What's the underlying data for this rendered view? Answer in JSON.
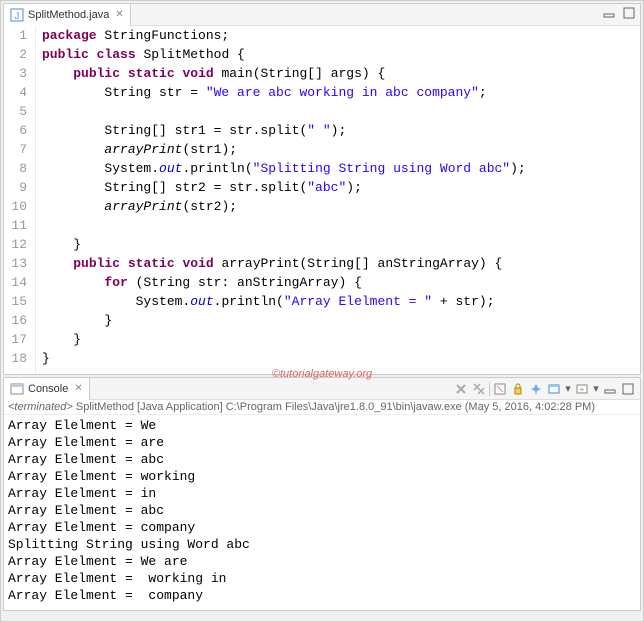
{
  "editor": {
    "tab_label": "SplitMethod.java",
    "code_lines": [
      {
        "n": "1",
        "html": "<span class='kw'>package</span> StringFunctions;"
      },
      {
        "n": "2",
        "html": "<span class='kw'>public</span> <span class='kw'>class</span> SplitMethod {"
      },
      {
        "n": "3",
        "html": "    <span class='kw'>public</span> <span class='kw'>static</span> <span class='kw'>void</span> main(String[] args) {"
      },
      {
        "n": "4",
        "html": "        String str = <span class='str'>\"We are abc working in abc company\"</span>;"
      },
      {
        "n": "5",
        "html": ""
      },
      {
        "n": "6",
        "html": "        String[] str1 = str.split(<span class='str'>\" \"</span>);"
      },
      {
        "n": "7",
        "html": "        <span class='mtd'>arrayPrint</span>(str1);"
      },
      {
        "n": "8",
        "html": "        System.<span class='fld'>out</span>.println(<span class='str'>\"Splitting String using Word abc\"</span>);"
      },
      {
        "n": "9",
        "html": "        String[] str2 = str.split(<span class='str'>\"abc\"</span>);"
      },
      {
        "n": "10",
        "html": "        <span class='mtd'>arrayPrint</span>(str2);"
      },
      {
        "n": "11",
        "html": ""
      },
      {
        "n": "12",
        "html": "    }"
      },
      {
        "n": "13",
        "html": "    <span class='kw'>public</span> <span class='kw'>static</span> <span class='kw'>void</span> arrayPrint(String[] anStringArray) {"
      },
      {
        "n": "14",
        "html": "        <span class='kw'>for</span> (String str: anStringArray) {"
      },
      {
        "n": "15",
        "html": "            System.<span class='fld'>out</span>.println(<span class='str'>\"Array Elelment = \"</span> + str);"
      },
      {
        "n": "16",
        "html": "        }"
      },
      {
        "n": "17",
        "html": "    }"
      },
      {
        "n": "18",
        "html": "}"
      }
    ]
  },
  "watermark": "©tutorialgateway.org",
  "console": {
    "tab_label": "Console",
    "status_prefix": "<terminated>",
    "status_text": " SplitMethod [Java Application] C:\\Program Files\\Java\\jre1.8.0_91\\bin\\javaw.exe (May 5, 2016, 4:02:28 PM)",
    "output": [
      "Array Elelment = We",
      "Array Elelment = are",
      "Array Elelment = abc",
      "Array Elelment = working",
      "Array Elelment = in",
      "Array Elelment = abc",
      "Array Elelment = company",
      "Splitting String using Word abc",
      "Array Elelment = We are ",
      "Array Elelment =  working in ",
      "Array Elelment =  company"
    ]
  }
}
